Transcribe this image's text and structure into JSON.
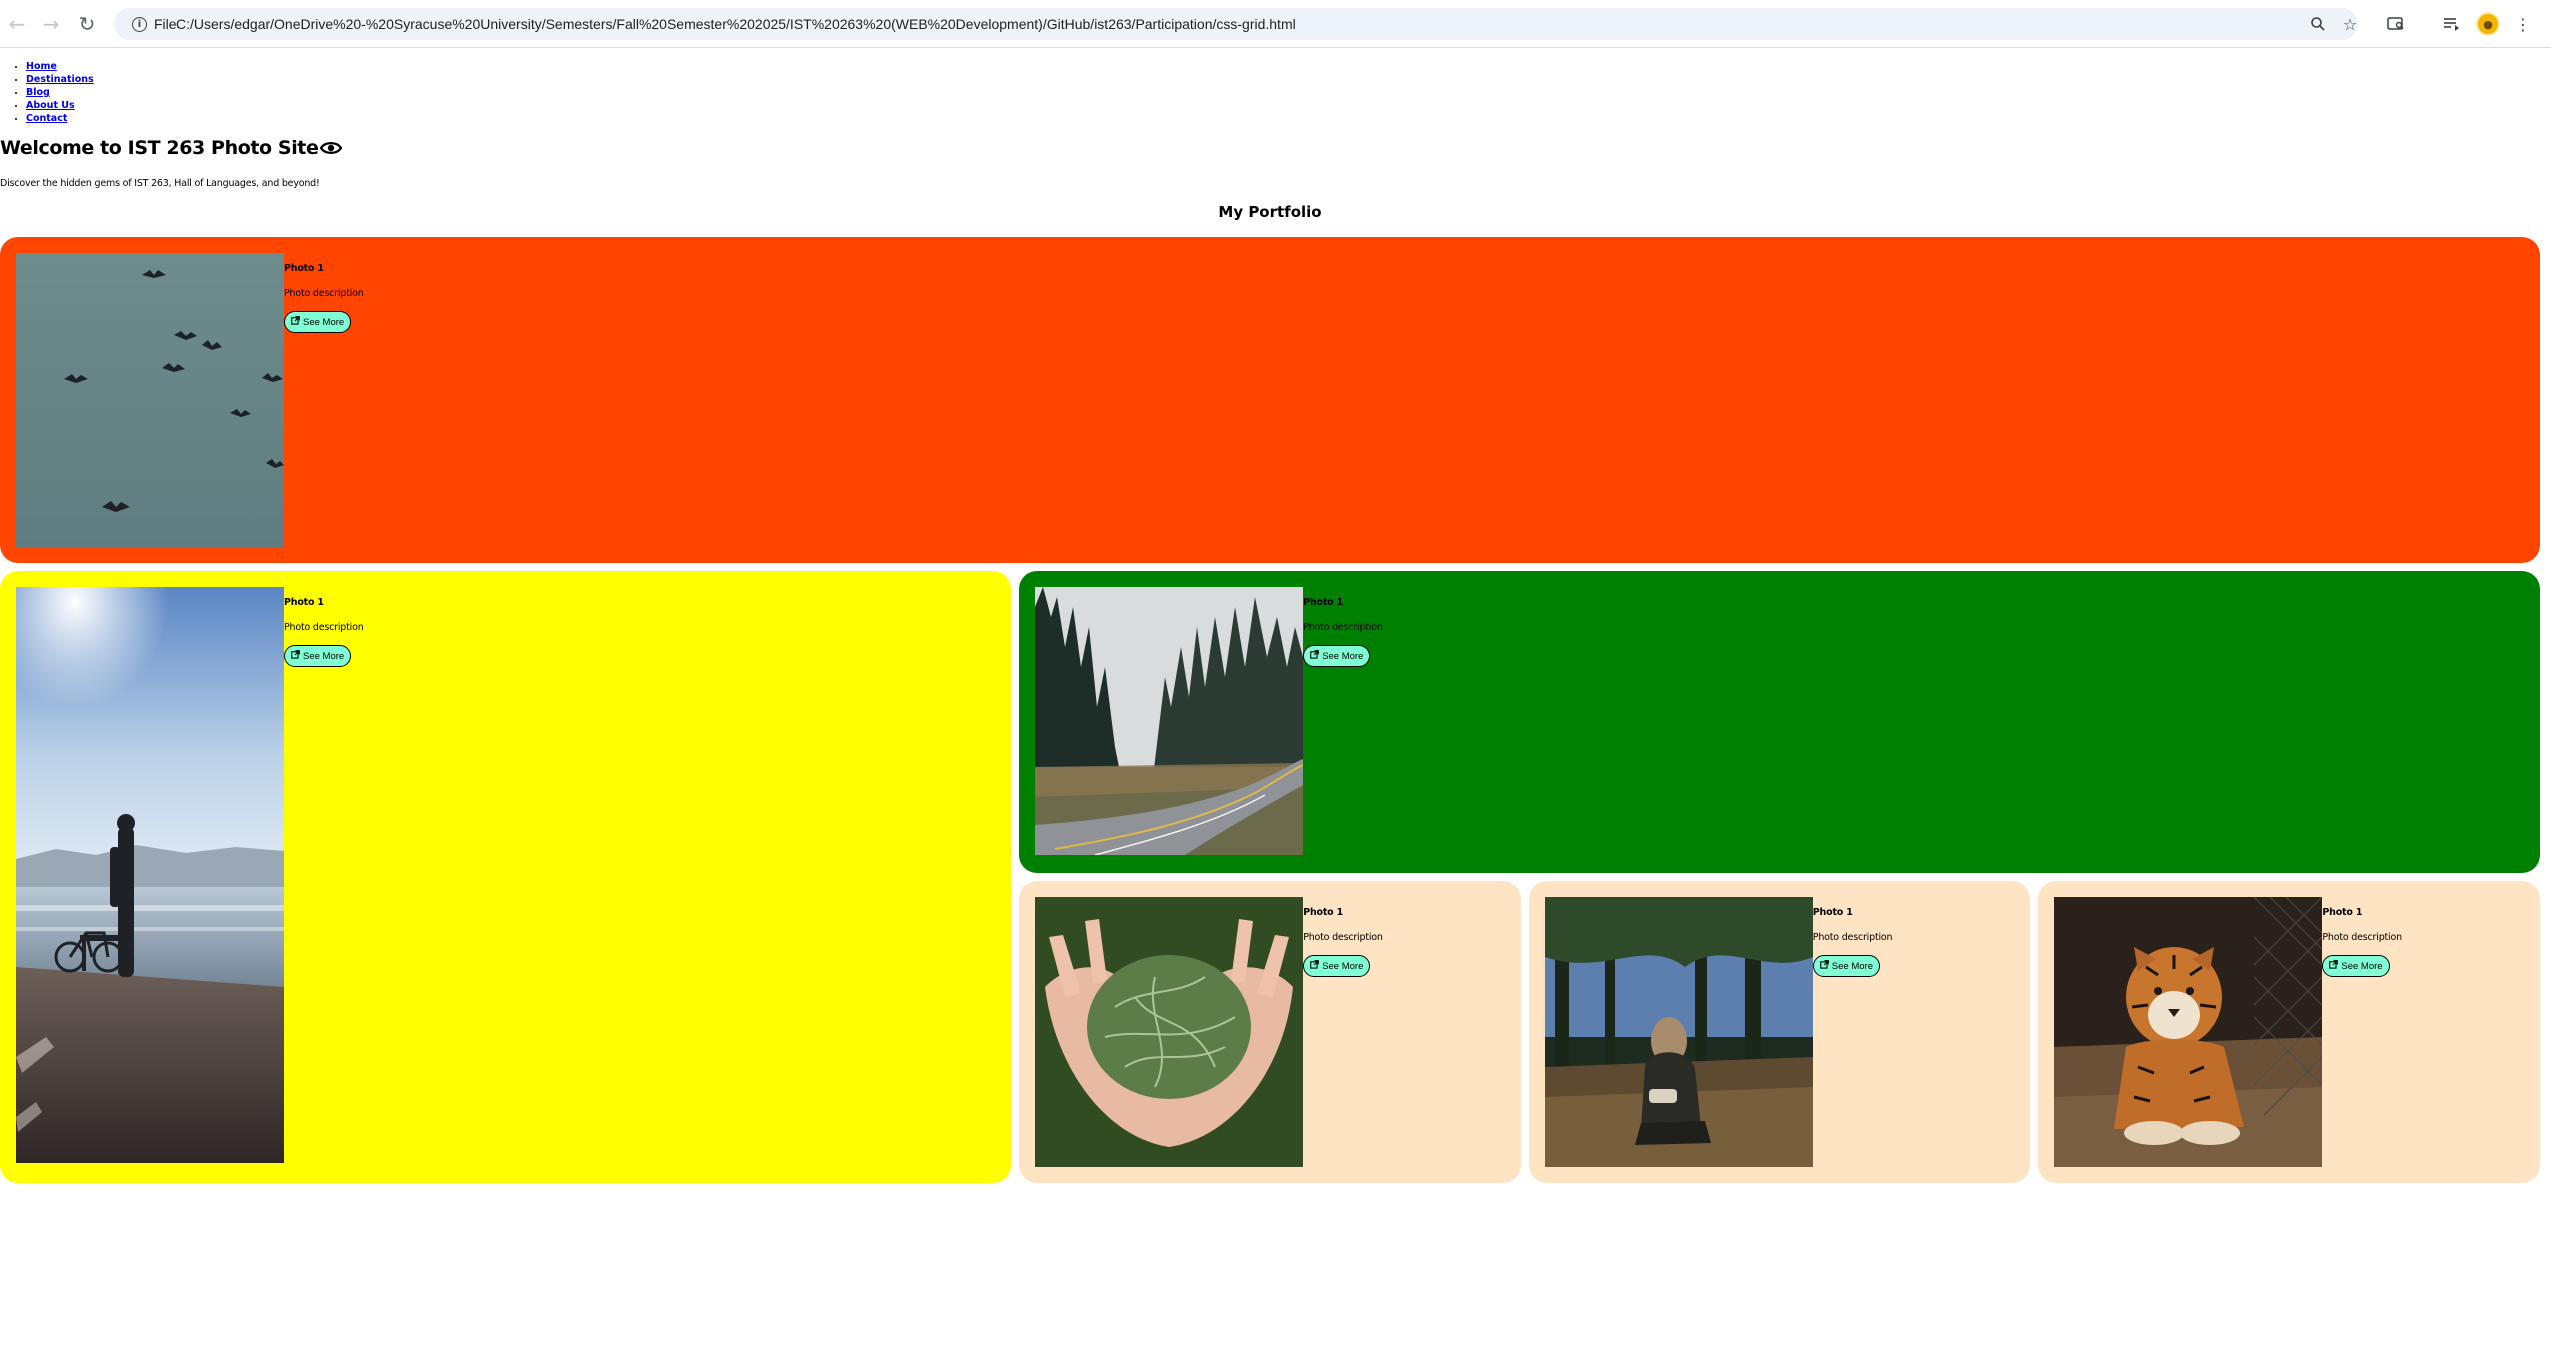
{
  "browser": {
    "site_info_label": "File",
    "url": "C:/Users/edgar/OneDrive%20-%20Syracuse%20University/Semesters/Fall%20Semester%202025/IST%20263%20(WEB%20Development)/GitHub/ist263/Participation/css-grid.html"
  },
  "nav": {
    "items": [
      {
        "label": "Home"
      },
      {
        "label": "Destinations"
      },
      {
        "label": "Blog"
      },
      {
        "label": "About Us"
      },
      {
        "label": "Contact"
      }
    ]
  },
  "header": {
    "title": "Welcome to IST 263 Photo Site",
    "tagline": "Discover the hidden gems of IST 263, Hall of Languages, and beyond!"
  },
  "portfolio": {
    "heading": "My Portfolio",
    "cards": [
      {
        "photo_title": "Photo 1",
        "photo_desc": "Photo description",
        "button_label": "See More",
        "photo_icon": "birds-photo"
      },
      {
        "photo_title": "Photo 1",
        "photo_desc": "Photo description",
        "button_label": "See More",
        "photo_icon": "lake-cyclist-photo"
      },
      {
        "photo_title": "Photo 1",
        "photo_desc": "Photo description",
        "button_label": "See More",
        "photo_icon": "forest-road-photo"
      },
      {
        "photo_title": "Photo 1",
        "photo_desc": "Photo description",
        "button_label": "See More",
        "photo_icon": "hands-pine-photo"
      },
      {
        "photo_title": "Photo 1",
        "photo_desc": "Photo description",
        "button_label": "See More",
        "photo_icon": "woman-forest-photo"
      },
      {
        "photo_title": "Photo 1",
        "photo_desc": "Photo description",
        "button_label": "See More",
        "photo_icon": "tiger-photo"
      }
    ]
  },
  "colors": {
    "card_orange": "#ff4500",
    "card_yellow": "#ffff00",
    "card_green": "#008000",
    "card_tan": "#ffe4c4",
    "button_bg": "#7fffd4",
    "link": "#0000ee"
  }
}
